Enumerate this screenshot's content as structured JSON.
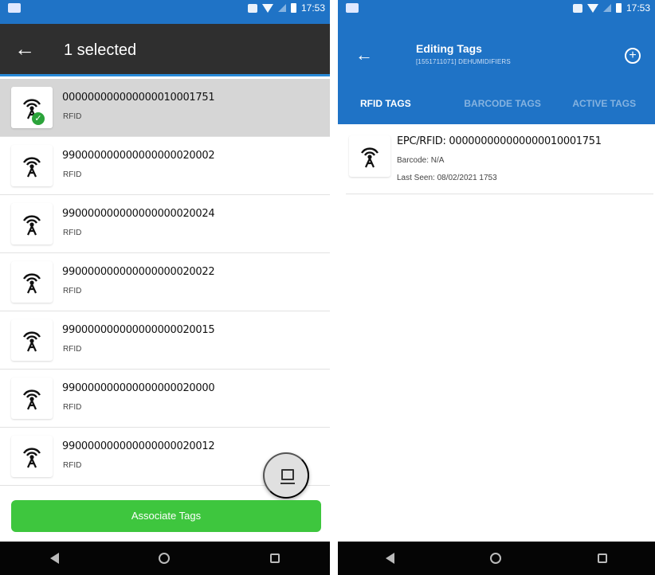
{
  "status_bar": {
    "time": "17:53"
  },
  "left_screen": {
    "header": {
      "back_icon": "←",
      "title": "1 selected"
    },
    "tags": [
      {
        "id": "000000000000000010001751",
        "type": "RFID",
        "selected": true
      },
      {
        "id": "990000000000000000020002",
        "type": "RFID",
        "selected": false
      },
      {
        "id": "990000000000000000020024",
        "type": "RFID",
        "selected": false
      },
      {
        "id": "990000000000000000020022",
        "type": "RFID",
        "selected": false
      },
      {
        "id": "990000000000000000020015",
        "type": "RFID",
        "selected": false
      },
      {
        "id": "990000000000000000020000",
        "type": "RFID",
        "selected": false
      },
      {
        "id": "990000000000000000020012",
        "type": "RFID",
        "selected": false
      }
    ],
    "associate_button": "Associate Tags"
  },
  "right_screen": {
    "header": {
      "back_icon": "←",
      "title": "Editing Tags",
      "subtitle": "[1551711071] DEHUMIDIFIERS",
      "add_icon": "+"
    },
    "tabs": [
      {
        "label": "RFID TAGS",
        "active": true
      },
      {
        "label": "BARCODE TAGS",
        "active": false
      },
      {
        "label": "ACTIVE TAGS",
        "active": false
      }
    ],
    "tag_detail": {
      "epc": "EPC/RFID: 000000000000000010001751",
      "barcode": "Barcode: N/A",
      "last_seen": "Last Seen: 08/02/2021 1753"
    }
  },
  "colors": {
    "primary_blue": "#1f73c6",
    "dark_bar": "#2f2f2f",
    "accent_green": "#3ec63e",
    "selected_row": "#d6d6d6"
  },
  "icons": {
    "tag": "rfid-antenna-icon",
    "check": "check-circle-icon",
    "fab": "desktop-icon"
  }
}
